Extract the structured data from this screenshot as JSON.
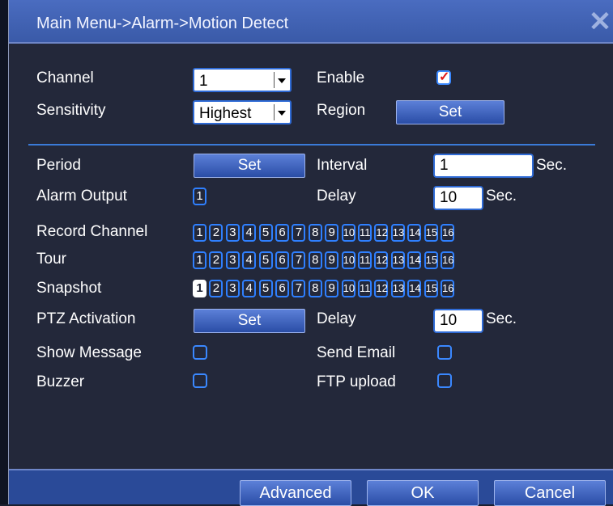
{
  "title": "Main Menu->Alarm->Motion Detect",
  "icons": {
    "close": "close-icon",
    "dropdown": "chevron-down-icon",
    "check": "checkmark-icon"
  },
  "colors": {
    "accent": "#2f80ff",
    "titlebar": "#4a6cc0",
    "background": "#23283a",
    "checkmark": "#e01818"
  },
  "channel": {
    "label": "Channel",
    "value": "1"
  },
  "enable": {
    "label": "Enable",
    "checked": true
  },
  "sensitivity": {
    "label": "Sensitivity",
    "value": "Highest"
  },
  "region": {
    "label": "Region",
    "button": "Set"
  },
  "period": {
    "label": "Period",
    "button": "Set"
  },
  "interval": {
    "label": "Interval",
    "value": "1",
    "unit": "Sec."
  },
  "alarm_output": {
    "label": "Alarm Output",
    "channels": [
      "1"
    ]
  },
  "delay1": {
    "label": "Delay",
    "value": "10",
    "unit": "Sec."
  },
  "record_channel": {
    "label": "Record Channel",
    "channels": [
      "1",
      "2",
      "3",
      "4",
      "5",
      "6",
      "7",
      "8",
      "9",
      "10",
      "11",
      "12",
      "13",
      "14",
      "15",
      "16"
    ]
  },
  "tour": {
    "label": "Tour",
    "channels": [
      "1",
      "2",
      "3",
      "4",
      "5",
      "6",
      "7",
      "8",
      "9",
      "10",
      "11",
      "12",
      "13",
      "14",
      "15",
      "16"
    ]
  },
  "snapshot": {
    "label": "Snapshot",
    "channels": [
      "1",
      "2",
      "3",
      "4",
      "5",
      "6",
      "7",
      "8",
      "9",
      "10",
      "11",
      "12",
      "13",
      "14",
      "15",
      "16"
    ],
    "selected": [
      "1"
    ]
  },
  "ptz_activation": {
    "label": "PTZ Activation",
    "button": "Set"
  },
  "delay2": {
    "label": "Delay",
    "value": "10",
    "unit": "Sec."
  },
  "show_message": {
    "label": "Show Message",
    "checked": false
  },
  "send_email": {
    "label": "Send Email",
    "checked": false
  },
  "buzzer": {
    "label": "Buzzer",
    "checked": false
  },
  "ftp_upload": {
    "label": "FTP upload",
    "checked": false
  },
  "footer": {
    "advanced": "Advanced",
    "ok": "OK",
    "cancel": "Cancel"
  }
}
